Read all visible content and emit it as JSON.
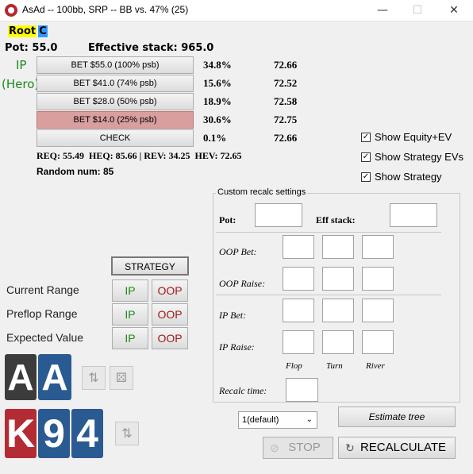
{
  "window": {
    "title": "AsAd -- 100bb, SRP -- BB vs. 47% (25)",
    "minimize": "—",
    "maximize": "☐",
    "close": "✕"
  },
  "breadcrumb": {
    "root": "Root",
    "current": "C"
  },
  "pot": "Pot: 55.0",
  "effective_stack": "Effective stack: 965.0",
  "player": {
    "pos": "IP",
    "role": "(Hero)"
  },
  "actions": [
    {
      "label": "BET $55.0 (100% psb)",
      "freq": "34.8%",
      "ev": "72.66",
      "selected": false
    },
    {
      "label": "BET $41.0 (74% psb)",
      "freq": "15.6%",
      "ev": "72.52",
      "selected": false
    },
    {
      "label": "BET $28.0 (50% psb)",
      "freq": "18.9%",
      "ev": "72.58",
      "selected": false
    },
    {
      "label": "BET $14.0 (25% psb)",
      "freq": "30.6%",
      "ev": "72.75",
      "selected": true
    },
    {
      "label": "CHECK",
      "freq": "0.1%",
      "ev": "72.66",
      "selected": false
    }
  ],
  "summary": "REQ: 55.49  HEQ: 85.66 | REV: 34.25  HEV: 72.65",
  "random_num": "Random num: 85",
  "checkboxes": [
    {
      "label": "Show Equity+EV",
      "checked": true
    },
    {
      "label": "Show Strategy EVs",
      "checked": true
    },
    {
      "label": "Show Strategy",
      "checked": true
    }
  ],
  "recalc": {
    "legend": "Custom recalc settings",
    "pot_label": "Pot:",
    "eff_stack_label": "Eff stack:",
    "oop_bet": "OOP Bet:",
    "oop_raise": "OOP Raise:",
    "ip_bet": "IP Bet:",
    "ip_raise": "IP Raise:",
    "streets": [
      "Flop",
      "Turn",
      "River"
    ],
    "recalc_time": "Recalc time:"
  },
  "strategy_button": "STRATEGY",
  "ranges": [
    {
      "label": "Current Range",
      "ip": "IP",
      "oop": "OOP"
    },
    {
      "label": "Preflop Range",
      "ip": "IP",
      "oop": "OOP"
    },
    {
      "label": "Expected Value",
      "ip": "IP",
      "oop": "OOP"
    }
  ],
  "hand_cards": [
    "A",
    "A"
  ],
  "board_cards": [
    "K",
    "9",
    "4"
  ],
  "threads_select": "1(default)",
  "estimate_tree": "Estimate tree",
  "stop": "STOP",
  "recalculate": "RECALCULATE",
  "colors": {
    "selected_action": "#d99e9e",
    "ip_green": "#1b8a1b",
    "oop_red": "#a01a1a",
    "root_highlight": "#ffff00",
    "current_highlight": "#3399ff"
  }
}
